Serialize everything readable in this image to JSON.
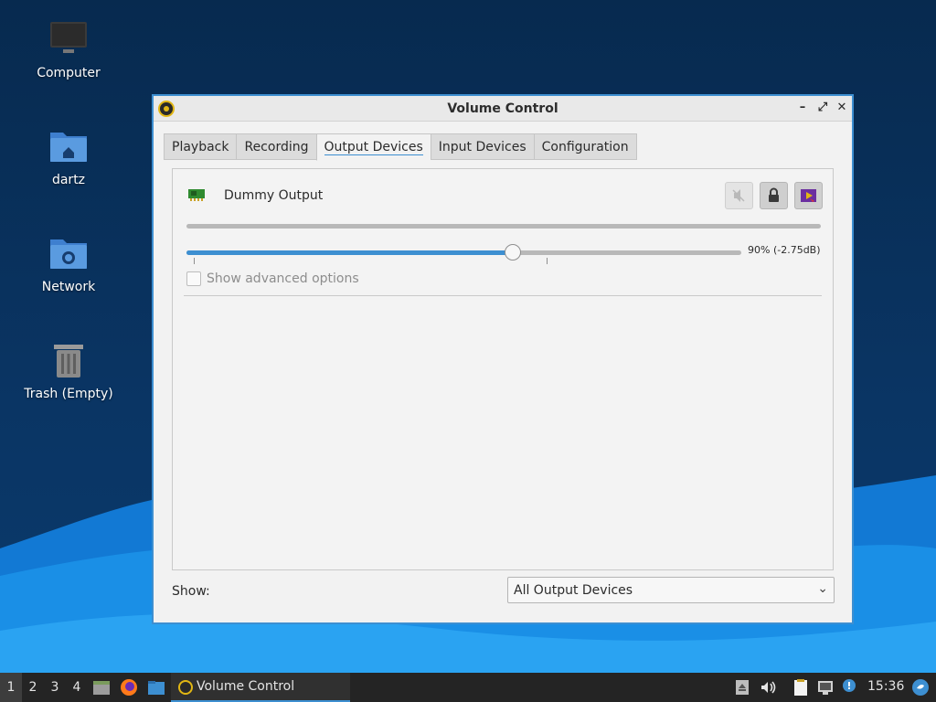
{
  "desktop": {
    "icons": [
      {
        "label": "Computer",
        "icon": "computer-icon"
      },
      {
        "label": "dartz",
        "icon": "home-folder-icon"
      },
      {
        "label": "Network",
        "icon": "network-folder-icon"
      },
      {
        "label": "Trash (Empty)",
        "icon": "trash-icon"
      }
    ]
  },
  "window": {
    "title": "Volume Control",
    "controls": {
      "minimize": "–",
      "maximize": "⤢",
      "close": "✕"
    },
    "tabs": [
      {
        "label": "Playback",
        "active": false
      },
      {
        "label": "Recording",
        "active": false
      },
      {
        "label": "Output Devices",
        "active": true
      },
      {
        "label": "Input Devices",
        "active": false
      },
      {
        "label": "Configuration",
        "active": false
      }
    ],
    "device": {
      "name": "Dummy Output",
      "volume_percent": 90,
      "volume_label": "90% (-2.75dB)",
      "peak_level": 0,
      "advanced_label": "Show advanced options",
      "advanced_checked": false
    },
    "filter": {
      "label": "Show:",
      "selected": "All Output Devices"
    }
  },
  "taskbar": {
    "workspaces": [
      "1",
      "2",
      "3",
      "4"
    ],
    "active_workspace": "1",
    "task_label": "Volume Control",
    "clock": "15:36"
  },
  "colors": {
    "accent": "#3d8fd1",
    "desktop_bg": "#0a3564",
    "wave_light": "#1a8fe6",
    "taskbar_bg": "#242424"
  }
}
